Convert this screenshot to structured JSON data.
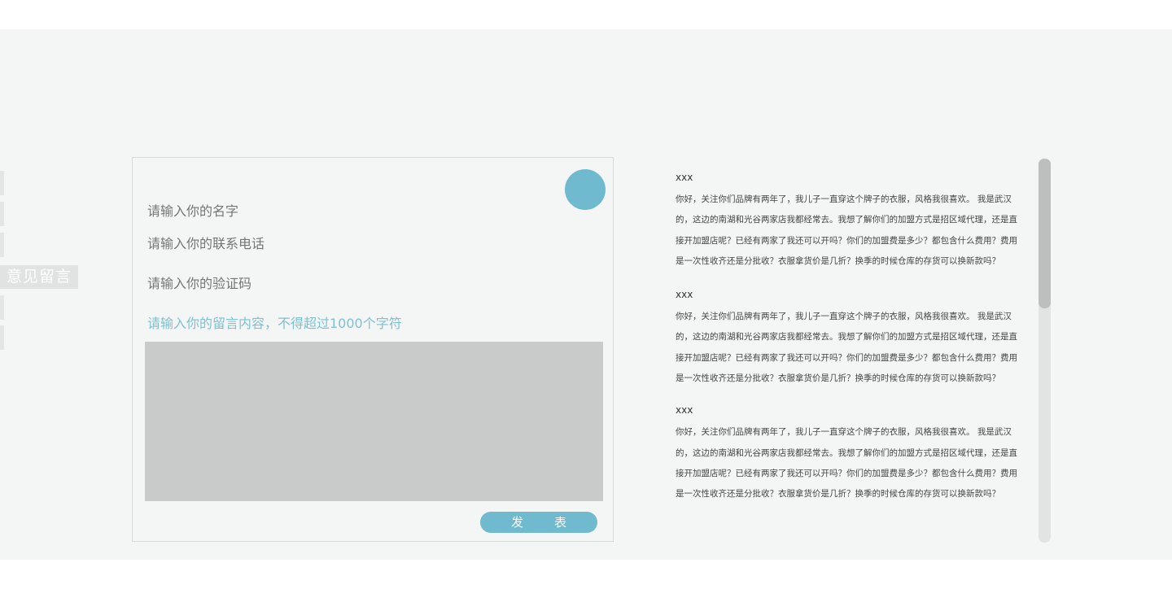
{
  "sidebar": {
    "active_label": "意见留言"
  },
  "form": {
    "name_placeholder": "请输入你的名字",
    "phone_placeholder": "请输入你的联系电话",
    "code_placeholder": "请输入你的验证码",
    "message_placeholder": "请输入你的留言内容，不得超过1000个字符",
    "submit_label": "发表"
  },
  "messages": [
    {
      "name": "xxx",
      "body": "你好，关注你们品牌有两年了，我儿子一直穿这个牌子的衣服，风格我很喜欢。  我是武汉的，这边的南湖和光谷两家店我都经常去。我想了解你们的加盟方式是招区域代理，还是直接开加盟店呢？已经有两家了我还可以开吗？你们的加盟费是多少？都包含什么费用？费用是一次性收齐还是分批收？衣服拿货价是几折？换季的时候仓库的存货可以换新款吗？"
    },
    {
      "name": "xxx",
      "body": "你好，关注你们品牌有两年了，我儿子一直穿这个牌子的衣服，风格我很喜欢。  我是武汉的，这边的南湖和光谷两家店我都经常去。我想了解你们的加盟方式是招区域代理，还是直接开加盟店呢？已经有两家了我还可以开吗？你们的加盟费是多少？都包含什么费用？费用是一次性收齐还是分批收？衣服拿货价是几折？换季的时候仓库的存货可以换新款吗？"
    },
    {
      "name": "xxx",
      "body": "你好，关注你们品牌有两年了，我儿子一直穿这个牌子的衣服，风格我很喜欢。  我是武汉的，这边的南湖和光谷两家店我都经常去。我想了解你们的加盟方式是招区域代理，还是直接开加盟店呢？已经有两家了我还可以开吗？你们的加盟费是多少？都包含什么费用？费用是一次性收齐还是分批收？衣服拿货价是几折？换季的时候仓库的存货可以换新款吗？"
    }
  ],
  "colors": {
    "accent": "#6fbacf",
    "placeholder": "#7cc0d2",
    "textarea": "#c9cbcb"
  }
}
